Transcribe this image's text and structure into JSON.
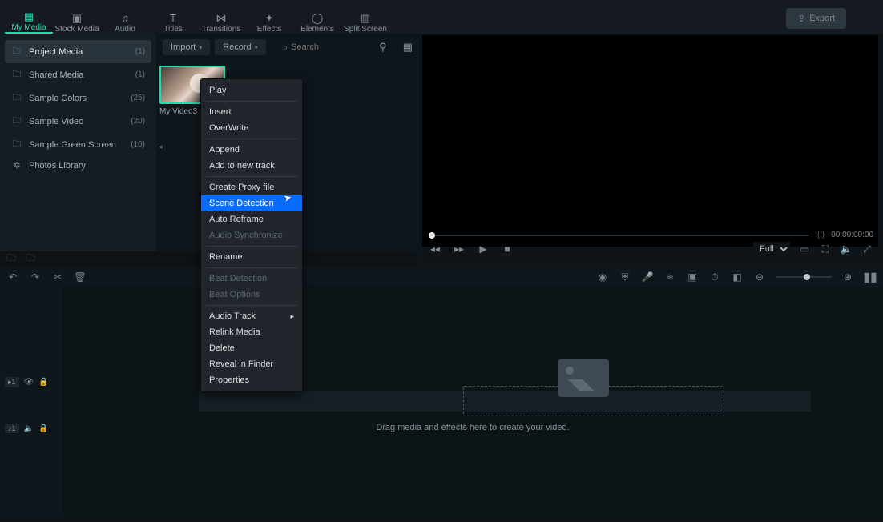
{
  "top_tabs": [
    {
      "label": "My Media",
      "icon": "▦"
    },
    {
      "label": "Stock Media",
      "icon": "▣"
    },
    {
      "label": "Audio",
      "icon": "♫"
    },
    {
      "label": "Titles",
      "icon": "T"
    },
    {
      "label": "Transitions",
      "icon": "⋈"
    },
    {
      "label": "Effects",
      "icon": "✦"
    },
    {
      "label": "Elements",
      "icon": "◯"
    },
    {
      "label": "Split Screen",
      "icon": "▥"
    }
  ],
  "active_top_tab": 0,
  "export_label": "Export",
  "sidebar": {
    "items": [
      {
        "icon": "🗀",
        "label": "Project Media",
        "count": "(1)"
      },
      {
        "icon": "🗀",
        "label": "Shared Media",
        "count": "(1)"
      },
      {
        "icon": "🗀",
        "label": "Sample Colors",
        "count": "(25)"
      },
      {
        "icon": "🗀",
        "label": "Sample Video",
        "count": "(20)"
      },
      {
        "icon": "🗀",
        "label": "Sample Green Screen",
        "count": "(10)"
      },
      {
        "icon": "✲",
        "label": "Photos Library",
        "count": ""
      }
    ],
    "active": 0
  },
  "toolbar": {
    "import": "Import",
    "record": "Record",
    "search_placeholder": "Search"
  },
  "clip": {
    "label": "My Video3"
  },
  "context_menu": {
    "groups": [
      [
        "Play"
      ],
      [
        "Insert",
        "OverWrite"
      ],
      [
        "Append",
        "Add to new track"
      ],
      [
        "Create Proxy file",
        "Scene Detection",
        "Auto Reframe",
        "Audio Synchronize"
      ],
      [
        "Rename"
      ],
      [
        "Beat Detection",
        "Beat Options"
      ],
      [
        "Audio Track",
        "Relink Media",
        "Delete",
        "Reveal in Finder",
        "Properties"
      ]
    ],
    "highlighted": "Scene Detection",
    "disabled": [
      "Audio Synchronize",
      "Beat Detection",
      "Beat Options"
    ],
    "submenu": [
      "Audio Track"
    ]
  },
  "preview": {
    "timecode_braces": "{        }",
    "timecode": "00:00:00:00",
    "quality": "Full"
  },
  "timeline": {
    "drop_hint": "Drag media and effects here to create your video.",
    "video_track": "1",
    "audio_track": "1"
  }
}
